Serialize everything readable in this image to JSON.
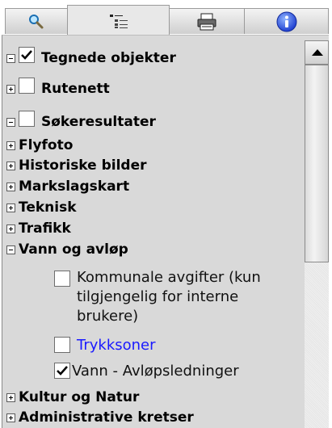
{
  "tabs": [
    {
      "name": "search",
      "icon": "magnifier-icon",
      "active": false
    },
    {
      "name": "layers",
      "icon": "layer-tree-icon",
      "active": true
    },
    {
      "name": "print",
      "icon": "printer-icon",
      "active": false
    },
    {
      "name": "info",
      "icon": "info-icon",
      "active": false
    }
  ],
  "tree": {
    "items": [
      {
        "label": "Tegnede objekter",
        "expander": "minus",
        "checkbox": true,
        "checked": true
      },
      {
        "label": "Rutenett",
        "expander": "plus",
        "checkbox": true,
        "checked": false
      },
      {
        "label": "Søkeresultater",
        "expander": "minus",
        "checkbox": true,
        "checked": false
      },
      {
        "label": "Flyfoto",
        "expander": "plus"
      },
      {
        "label": "Historiske bilder",
        "expander": "plus"
      },
      {
        "label": "Markslagskart",
        "expander": "plus"
      },
      {
        "label": "Teknisk",
        "expander": "plus"
      },
      {
        "label": "Trafikk",
        "expander": "plus"
      },
      {
        "label": "Vann og avløp",
        "expander": "minus"
      },
      {
        "label": "Kultur og Natur",
        "expander": "plus"
      },
      {
        "label": "Administrative kretser",
        "expander": "plus"
      }
    ],
    "vann_children": [
      {
        "lines": [
          "Kommunale avgifter (kun",
          "tilgjengelig for interne",
          "brukere)"
        ],
        "checked": false
      },
      {
        "lines": [
          "Trykksoner"
        ],
        "checked": false,
        "color": "#1a1aff"
      },
      {
        "lines": [
          "Vann - Avløpsledninger"
        ],
        "checked": true
      }
    ]
  }
}
